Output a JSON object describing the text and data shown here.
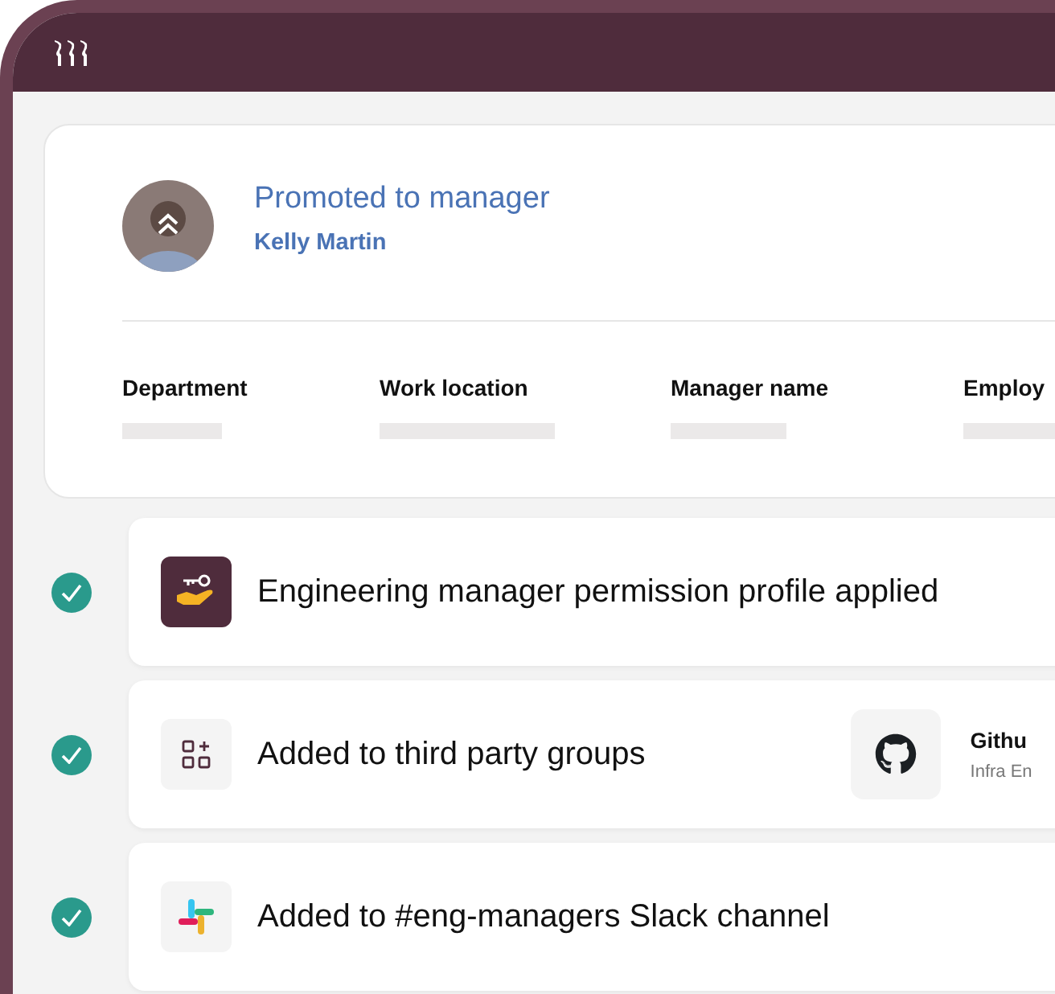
{
  "profile": {
    "title": "Promoted to manager",
    "name": "Kelly Martin",
    "fields": [
      {
        "label": "Department"
      },
      {
        "label": "Work location"
      },
      {
        "label": "Manager name"
      },
      {
        "label": "Employ"
      }
    ]
  },
  "steps": [
    {
      "kind": "permission",
      "text": "Engineering manager permission profile applied",
      "done": true
    },
    {
      "kind": "groups",
      "text": "Added to third party groups",
      "done": true,
      "integration": {
        "name": "Githu",
        "team": "Infra En"
      }
    },
    {
      "kind": "slack",
      "text": "Added to #eng-managers Slack channel",
      "done": true
    }
  ]
}
